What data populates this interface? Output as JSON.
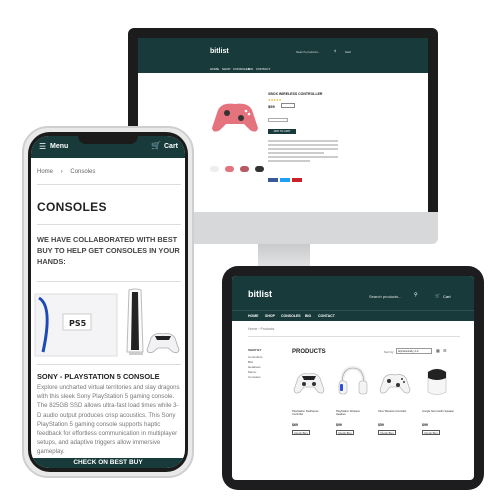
{
  "brand": "bitlist",
  "colors": {
    "primary": "#183a3a",
    "accent": "#e4737e"
  },
  "phone": {
    "menu_label": "Menu",
    "cart_label": "Cart",
    "breadcrumb": {
      "home": "Home",
      "current": "Consoles"
    },
    "page_title": "CONSOLES",
    "subtitle": "WE HAVE COLLABORATED WITH BEST BUY TO HELP GET CONSOLES IN YOUR HANDS:",
    "product_title": "SONY - PLAYSTATION 5 CONSOLE",
    "product_description": "Explore uncharted virtual territories and slay dragons with this sleek Sony PlayStation 5 gaming console. The 825GB SSD allows ultra-fast load times while 3-D audio output produces crisp acoustics. This Sony PlayStation 5 gaming console supports haptic feedback for effortless communication in multiplayer setups, and adaptive triggers allow immersive gameplay.",
    "cta_label": "CHECK ON BEST BUY"
  },
  "ipad": {
    "search_placeholder": "Search products...",
    "cart_label": "Cart",
    "nav": [
      "HOME",
      "SHOP",
      "CONSOLES",
      "BIO",
      "CONTACT"
    ],
    "breadcrumb": {
      "home": "Home",
      "current": "Products"
    },
    "sidebar_heading": "SHOP BY",
    "sidebar_items": [
      "Controllers",
      "Bits",
      "Headsets",
      "Memo",
      "Consoles"
    ],
    "products_heading": "PRODUCTS",
    "sort_label": "Sort by",
    "sort_value": "Alphabetically, A-Z",
    "products": [
      {
        "name": "PlayStation DualSense Controller",
        "price": "$69",
        "button": "Quick Buy"
      },
      {
        "name": "PlayStation Wireless Headset",
        "price": "$99",
        "button": "Quick Buy"
      },
      {
        "name": "Xbox Wireless Controller",
        "price": "$59",
        "button": "Quick Buy"
      },
      {
        "name": "Google Nest Audio Speaker",
        "price": "$99",
        "button": "Quick Buy"
      }
    ]
  },
  "imac": {
    "search_placeholder": "Search products...",
    "cart_label": "Cart",
    "nav": [
      "HOME",
      "SHOP",
      "CONSOLES",
      "BIO",
      "CONTACT"
    ],
    "product_title": "XBOX WIRELESS CONTROLLER",
    "price": "$59",
    "add_to_cart": "ADD TO CART"
  }
}
